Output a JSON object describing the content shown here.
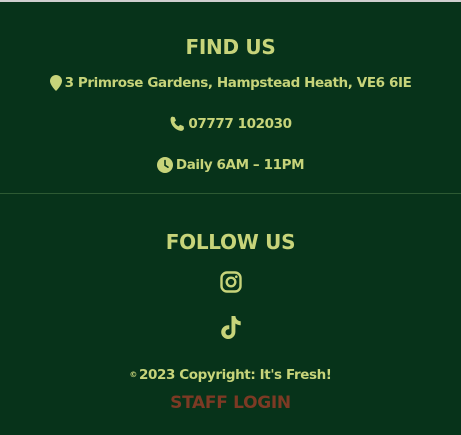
{
  "find_us": {
    "heading": "FIND US",
    "address": "3 Primrose Gardens, Hampstead Heath, VE6 6IE",
    "phone": "07777 102030",
    "hours": "Daily 6AM – 11PM",
    "icons": {
      "address": "map-marker-icon",
      "phone": "phone-icon",
      "hours": "clock-icon"
    }
  },
  "follow_us": {
    "heading": "FOLLOW US",
    "social": [
      {
        "icon": "instagram-icon"
      },
      {
        "icon": "tiktok-icon"
      }
    ]
  },
  "footer": {
    "copyright_symbol": "©",
    "copyright": "2023 Copyright: It's Fresh!",
    "staff_login": "STAFF LOGIN"
  },
  "colors": {
    "background": "#07331a",
    "accent": "#c7d47a",
    "staff_login": "#7c3a24",
    "divider": "#2d5a33"
  }
}
